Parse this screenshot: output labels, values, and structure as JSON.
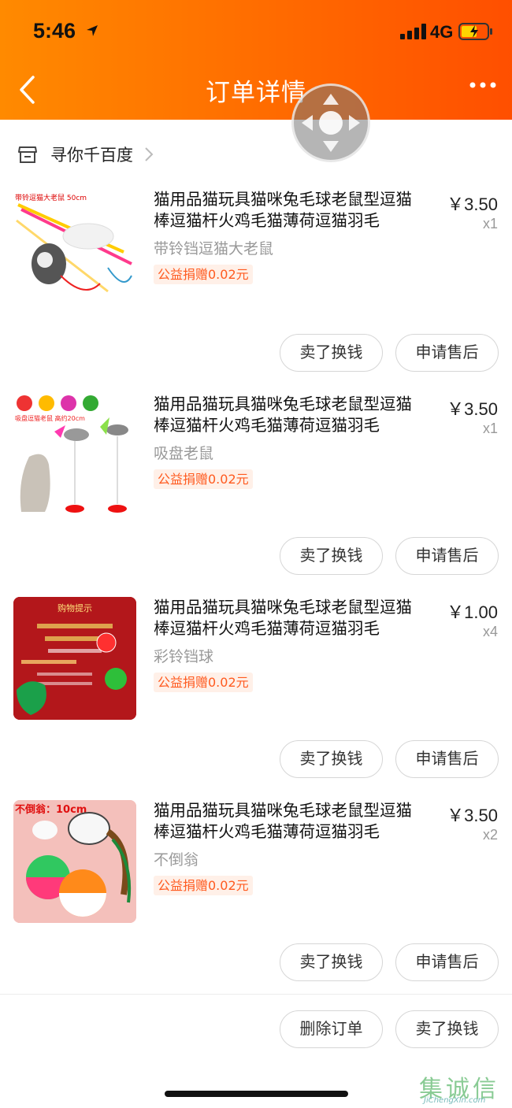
{
  "status": {
    "time": "5:46",
    "network": "4G"
  },
  "nav": {
    "title": "订单详情"
  },
  "shop": {
    "name": "寻你千百度"
  },
  "items": [
    {
      "title": "猫用品猫玩具猫咪兔毛球老鼠型逗猫棒逗猫杆火鸡毛猫薄荷逗猫羽毛",
      "sku": "带铃铛逗猫大老鼠",
      "charity": "公益捐赠0.02元",
      "price": "￥3.50",
      "qty": "x1",
      "sell_btn": "卖了换钱",
      "after_btn": "申请售后",
      "thumb_text": "带铃逗猫大老鼠 50cm"
    },
    {
      "title": "猫用品猫玩具猫咪兔毛球老鼠型逗猫棒逗猫杆火鸡毛猫薄荷逗猫羽毛",
      "sku": "吸盘老鼠",
      "charity": "公益捐赠0.02元",
      "price": "￥3.50",
      "qty": "x1",
      "sell_btn": "卖了换钱",
      "after_btn": "申请售后",
      "thumb_text": "吸盘逗猫老鼠 高约20cm"
    },
    {
      "title": "猫用品猫玩具猫咪兔毛球老鼠型逗猫棒逗猫杆火鸡毛猫薄荷逗猫羽毛",
      "sku": "彩铃铛球",
      "charity": "公益捐赠0.02元",
      "price": "￥1.00",
      "qty": "x4",
      "sell_btn": "卖了换钱",
      "after_btn": "申请售后",
      "thumb_text": "购物提示"
    },
    {
      "title": "猫用品猫玩具猫咪兔毛球老鼠型逗猫棒逗猫杆火鸡毛猫薄荷逗猫羽毛",
      "sku": "不倒翁",
      "charity": "公益捐赠0.02元",
      "price": "￥3.50",
      "qty": "x2",
      "sell_btn": "卖了换钱",
      "after_btn": "申请售后",
      "thumb_text": "不倒翁：10cm"
    }
  ],
  "footer": {
    "delete_btn": "删除订单",
    "sell_btn": "卖了换钱"
  },
  "watermark": {
    "text": "集诚信",
    "sub": "JiChengXin.com"
  },
  "colors": {
    "header_start": "#ff8a00",
    "header_end": "#ff4f00",
    "charity_text": "#ff5a1f"
  }
}
